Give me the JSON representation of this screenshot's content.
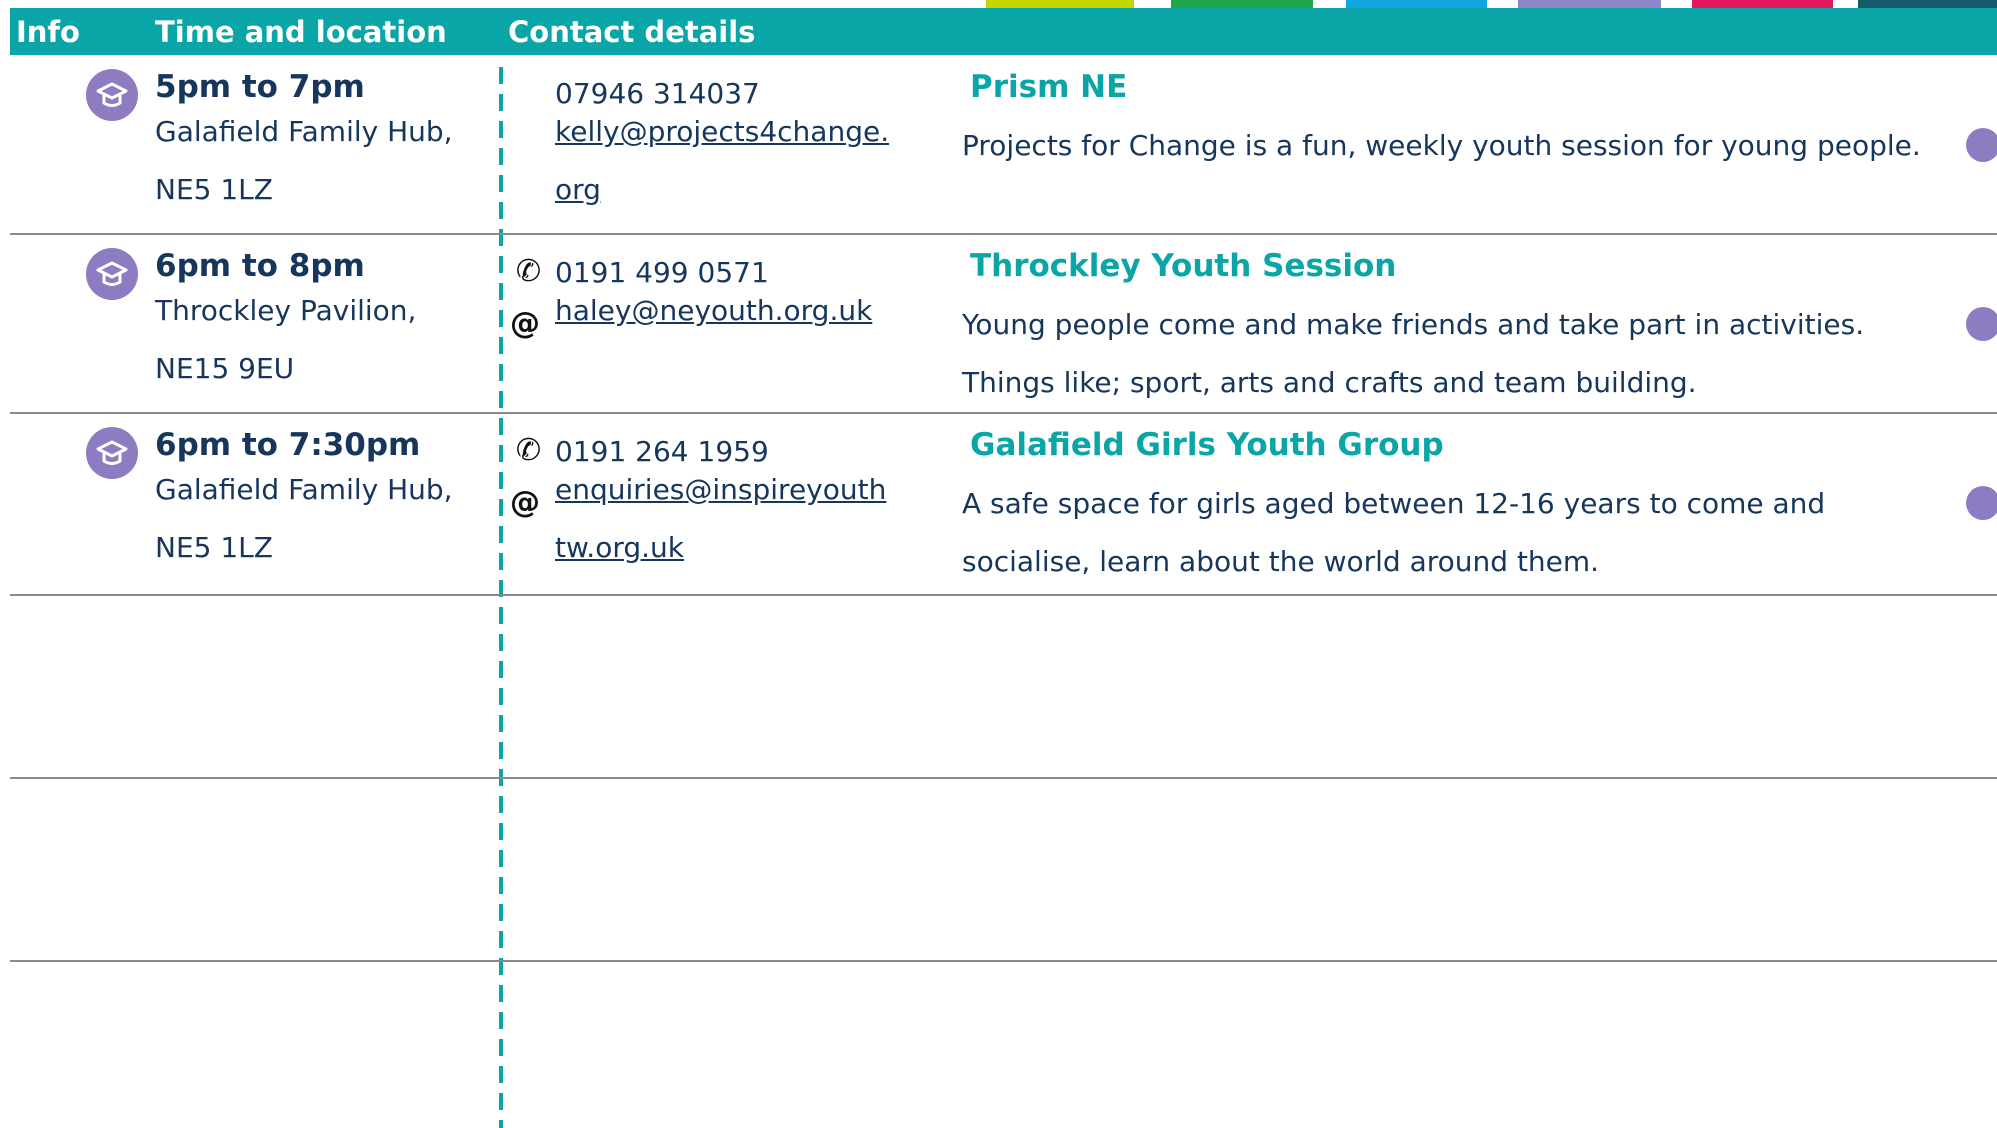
{
  "accents": [
    "#c4d600",
    "#1fa54a",
    "#10a7e0",
    "#8e86c8",
    "#e5175f",
    "#155a6a"
  ],
  "header": {
    "info": "Info",
    "time_location": "Time and location",
    "contact_details": "Contact details"
  },
  "icons": {
    "session": "graduation-cap-icon",
    "phone": "phone-icon",
    "email": "at-icon",
    "marker": "dot-icon"
  },
  "rows": [
    {
      "time": "5pm to 7pm",
      "location_line1": "Galafield Family Hub,",
      "location_line2": "NE5 1LZ",
      "phone": "07946 314037",
      "email": "kelly@projects4change.org",
      "title": "Prism NE",
      "description": "Projects for Change is a fun, weekly youth session for young people."
    },
    {
      "time": "6pm to 8pm",
      "location_line1": "Throckley Pavilion,",
      "location_line2": "NE15 9EU",
      "phone_icon": "✆",
      "phone": "0191 499 0571",
      "email_icon": "@",
      "email": "haley@neyouth.org.uk",
      "title": "Throckley Youth Session",
      "description": "Young people come and make friends and take part in activities. Things like; sport, arts and crafts and team building."
    },
    {
      "time": "6pm to 7:30pm",
      "location_line1": "Galafield Family Hub,",
      "location_line2": "NE5 1LZ",
      "phone_icon": "✆",
      "phone": "0191 264 1959",
      "email_icon": "@",
      "email": "enquiries@inspireyouthtw.org.uk",
      "title": "Galafield Girls Youth Group",
      "description": "A safe space for girls aged between 12-16 years to come and socialise, learn about the world around them."
    }
  ]
}
